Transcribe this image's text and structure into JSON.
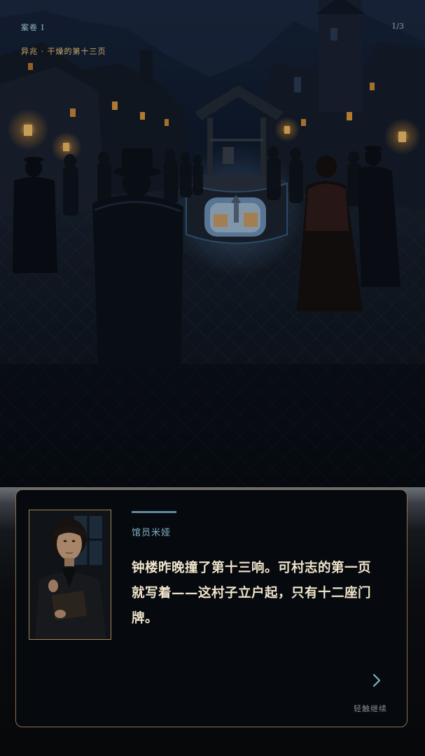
{
  "hud": {
    "chapter": "案卷 I",
    "page_indicator": "1/3",
    "subtitle": "异兆 · 干燥的第十三页"
  },
  "scene": {
    "description_icon": "village-square-night-illustration"
  },
  "dialog": {
    "speaker": "馆员米娅",
    "text": "钟楼昨晚撞了第十三响。可村志的第一页就写着——这村子立户起，只有十二座门牌。",
    "continue_label": "轻触继续",
    "continue_icon": "chevron-right-icon",
    "portrait_icon": "librarian-portrait"
  },
  "colors": {
    "accent_gold": "#c9a869",
    "accent_blue": "#7fb1c4",
    "frame_gold": "#8c7347"
  }
}
